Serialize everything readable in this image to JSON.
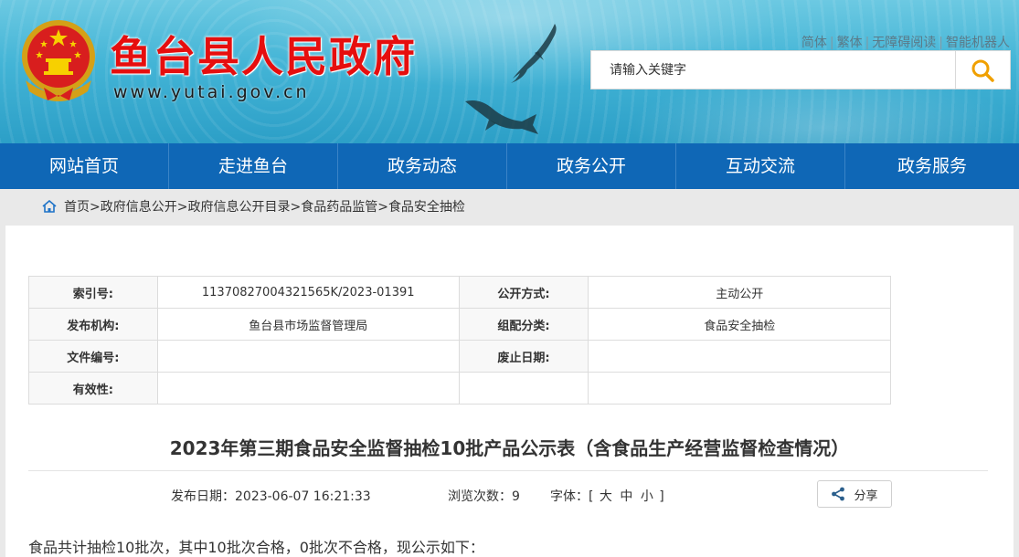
{
  "header": {
    "site_title": "鱼台县人民政府",
    "site_url": "www.yutai.gov.cn",
    "top_links": [
      "简体",
      "繁体",
      "无障碍阅读",
      "智能机器人"
    ],
    "search": {
      "placeholder": "请输入关键字"
    },
    "colors": {
      "title_red": "#e60e0e",
      "water_blue": "#43b4d6",
      "search_icon": "#f0a000"
    }
  },
  "nav": {
    "items": [
      "网站首页",
      "走进鱼台",
      "政务动态",
      "政务公开",
      "互动交流",
      "政务服务"
    ],
    "color": "#0f67b6"
  },
  "breadcrumb": {
    "items": [
      "首页",
      "政府信息公开",
      "政府信息公开目录",
      "食品药品监管",
      "食品安全抽检"
    ],
    "separator": ">"
  },
  "meta_table": {
    "rows": [
      {
        "label1": "索引号:",
        "value1": "11370827004321565K/2023-01391",
        "label2": "公开方式:",
        "value2": "主动公开"
      },
      {
        "label1": "发布机构:",
        "value1": "鱼台县市场监督管理局",
        "label2": "组配分类:",
        "value2": "食品安全抽检"
      },
      {
        "label1": "文件编号:",
        "value1": "",
        "label2": "废止日期:",
        "value2": ""
      },
      {
        "label1": "有效性:",
        "value1": "",
        "label2": "",
        "value2": ""
      }
    ]
  },
  "article": {
    "title": "2023年第三期食品安全监督抽检10批产品公示表（含食品生产经营监督检查情况）",
    "publish_date_label": "发布日期：",
    "publish_date": "2023-06-07 16:21:33",
    "views_label": "浏览次数：",
    "views": "9",
    "font_label": "字体：[",
    "font_sizes": [
      "大",
      "中",
      "小"
    ],
    "font_close": "]",
    "share_label": "分享",
    "intro": "食品共计抽检10批次，其中10批次合格，0批次不合格，现公示如下："
  }
}
